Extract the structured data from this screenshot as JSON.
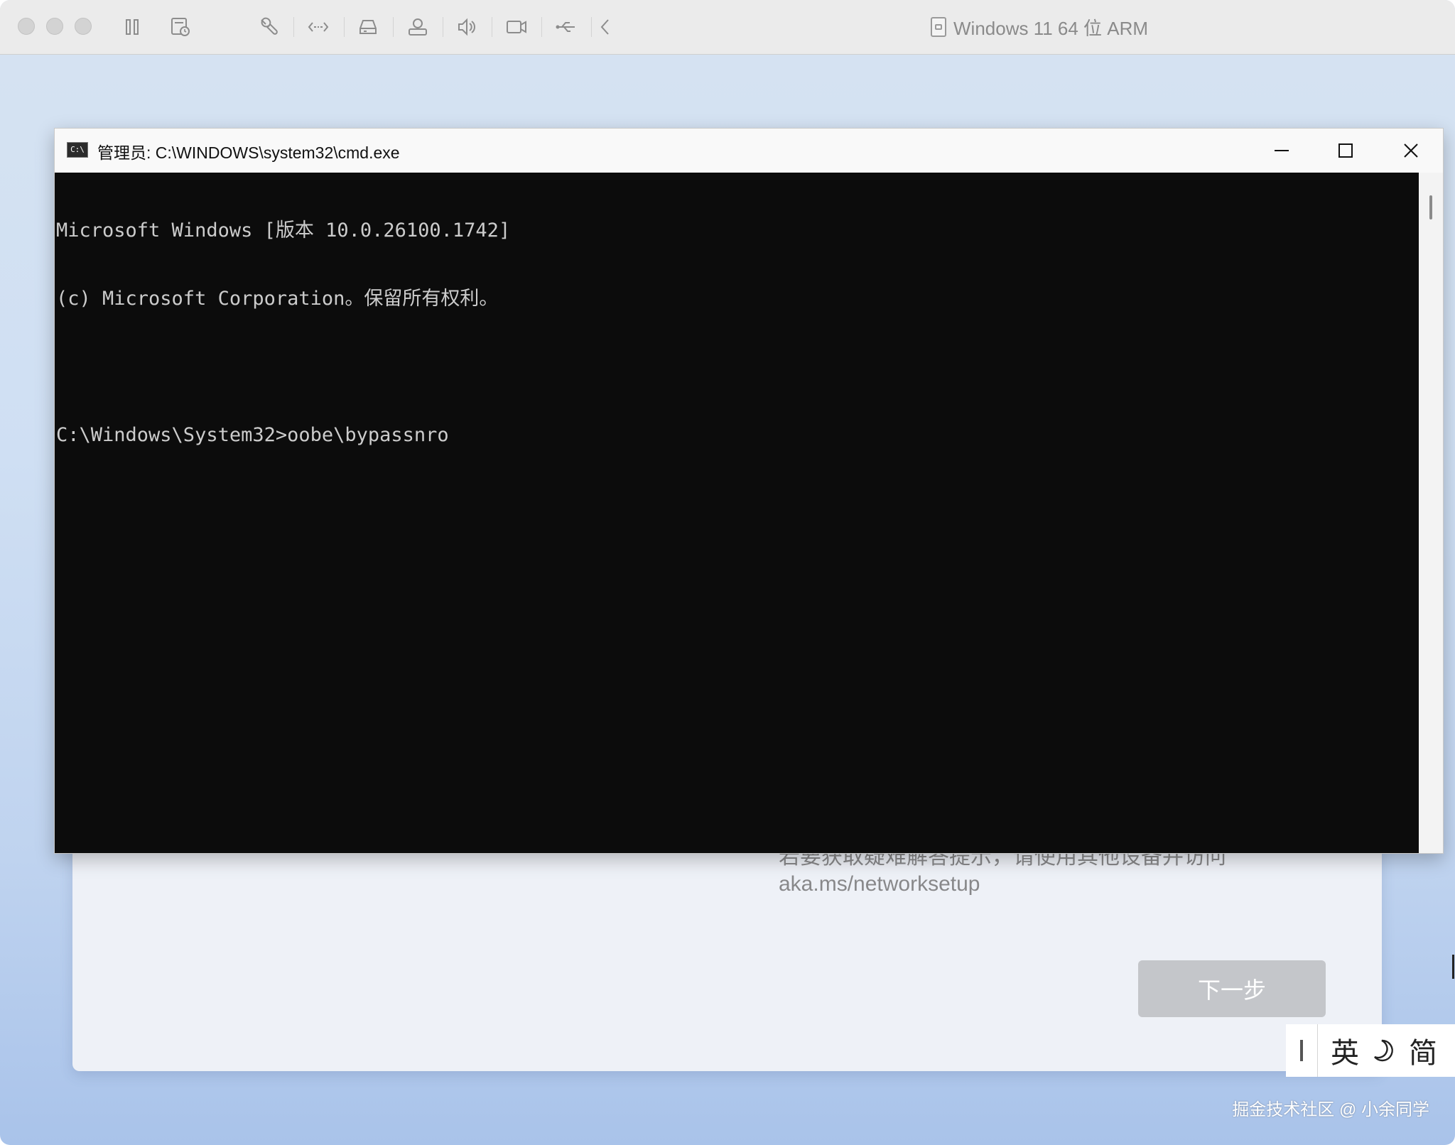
{
  "vm": {
    "title": "Windows 11 64 位 ARM"
  },
  "toolbar": {
    "icons": [
      "pause-icon",
      "snapshot-icon",
      "wrench-icon",
      "network-arrows-icon",
      "drive-icon",
      "printer-icon",
      "speaker-icon",
      "camera-icon",
      "usb-icon",
      "back-chevron-icon"
    ]
  },
  "cmd": {
    "title": "管理员: C:\\WINDOWS\\system32\\cmd.exe",
    "icon_text": "C:\\",
    "lines": [
      "Microsoft Windows [版本 10.0.26100.1742]",
      "(c) Microsoft Corporation。保留所有权利。",
      "",
      "C:\\Windows\\System32>oobe\\bypassnro"
    ]
  },
  "oobe": {
    "help_text": "若要获取疑难解答提示，请使用其他设备并访问 aka.ms/networksetup",
    "next_label": "下一步"
  },
  "ime": {
    "mode_label": "英",
    "script_label": "简"
  },
  "watermark": "掘金技术社区 @ 小余同学"
}
